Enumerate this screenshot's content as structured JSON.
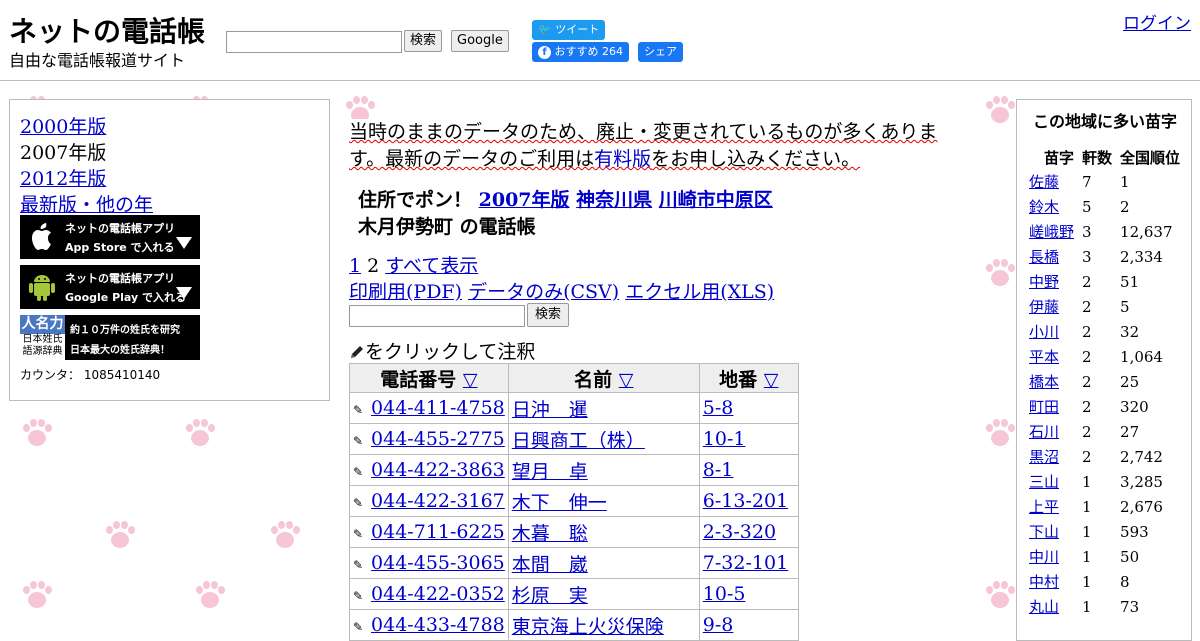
{
  "header": {
    "site_title": "ネットの電話帳",
    "site_subtitle": "自由な電話帳報道サイト",
    "search_button": "検索",
    "google_button": "Google",
    "tweet_button": "ツイート",
    "fb_recommend": "おすすめ 264",
    "share_button": "シェア",
    "login": "ログイン"
  },
  "left": {
    "years": [
      "2000年版",
      "2007年版",
      "2012年版",
      "最新版・他の年"
    ],
    "appstore": {
      "line1": "ネットの電話帳アプリ",
      "line2": "App Store で入れる"
    },
    "googleplay": {
      "line1": "ネットの電話帳アプリ",
      "line2": "Google Play で入れる"
    },
    "jinmei": {
      "logo": "人名力",
      "logo_sub": "日本姓氏語源辞典",
      "line1": "約１０万件の姓氏を研究",
      "line2": "日本最大の姓氏辞典！"
    },
    "counter": "カウンタ： 1085410140"
  },
  "notice": {
    "before": "当時のままのデータのため、廃止・変更されているものが多くあります。最新のデータのご利用は",
    "link": "有料版",
    "after": "をお申し込みください。"
  },
  "address": {
    "prefix": "住所でポン！",
    "edition": "2007年版",
    "prefecture": "神奈川県",
    "city": "川崎市中原区",
    "town": "木月伊勢町",
    "suffix": "の電話帳"
  },
  "pager": {
    "page1": "1",
    "page2": "2",
    "show_all": "すべて表示"
  },
  "exports": {
    "pdf": "印刷用(PDF)",
    "csv": "データのみ(CSV)",
    "xls": "エクセル用(XLS)"
  },
  "center_search_button": "検索",
  "annot_hint": "をクリックして注釈",
  "table": {
    "headers": [
      "電話番号",
      "名前",
      "地番"
    ],
    "sort_icon": "▽",
    "rows": [
      {
        "phone": "044-411-4758",
        "name": "日沖　暹",
        "lot": "5-8"
      },
      {
        "phone": "044-455-2775",
        "name": "日興商工（株）",
        "lot": "10-1"
      },
      {
        "phone": "044-422-3863",
        "name": "望月　卓",
        "lot": "8-1"
      },
      {
        "phone": "044-422-3167",
        "name": "木下　伸一",
        "lot": "6-13-201"
      },
      {
        "phone": "044-711-6225",
        "name": "木暮　聡",
        "lot": "2-3-320"
      },
      {
        "phone": "044-455-3065",
        "name": "本間　崴",
        "lot": "7-32-101"
      },
      {
        "phone": "044-422-0352",
        "name": "杉原　実",
        "lot": "10-5"
      },
      {
        "phone": "044-433-4788",
        "name": "東京海上火災保険",
        "lot": "9-8"
      }
    ]
  },
  "surnames": {
    "title": "この地域に多い苗字",
    "headers": [
      "苗字",
      "軒数",
      "全国順位"
    ],
    "rows": [
      {
        "name": "佐藤",
        "count": "7",
        "rank": "1"
      },
      {
        "name": "鈴木",
        "count": "5",
        "rank": "2"
      },
      {
        "name": "嵯峨野",
        "count": "3",
        "rank": "12,637"
      },
      {
        "name": "長橋",
        "count": "3",
        "rank": "2,334"
      },
      {
        "name": "中野",
        "count": "2",
        "rank": "51"
      },
      {
        "name": "伊藤",
        "count": "2",
        "rank": "5"
      },
      {
        "name": "小川",
        "count": "2",
        "rank": "32"
      },
      {
        "name": "平本",
        "count": "2",
        "rank": "1,064"
      },
      {
        "name": "橋本",
        "count": "2",
        "rank": "25"
      },
      {
        "name": "町田",
        "count": "2",
        "rank": "320"
      },
      {
        "name": "石川",
        "count": "2",
        "rank": "27"
      },
      {
        "name": "黒沼",
        "count": "2",
        "rank": "2,742"
      },
      {
        "name": "三山",
        "count": "1",
        "rank": "3,285"
      },
      {
        "name": "上平",
        "count": "1",
        "rank": "2,676"
      },
      {
        "name": "下山",
        "count": "1",
        "rank": "593"
      },
      {
        "name": "中川",
        "count": "1",
        "rank": "50"
      },
      {
        "name": "中村",
        "count": "1",
        "rank": "8"
      },
      {
        "name": "丸山",
        "count": "1",
        "rank": "73"
      }
    ]
  }
}
